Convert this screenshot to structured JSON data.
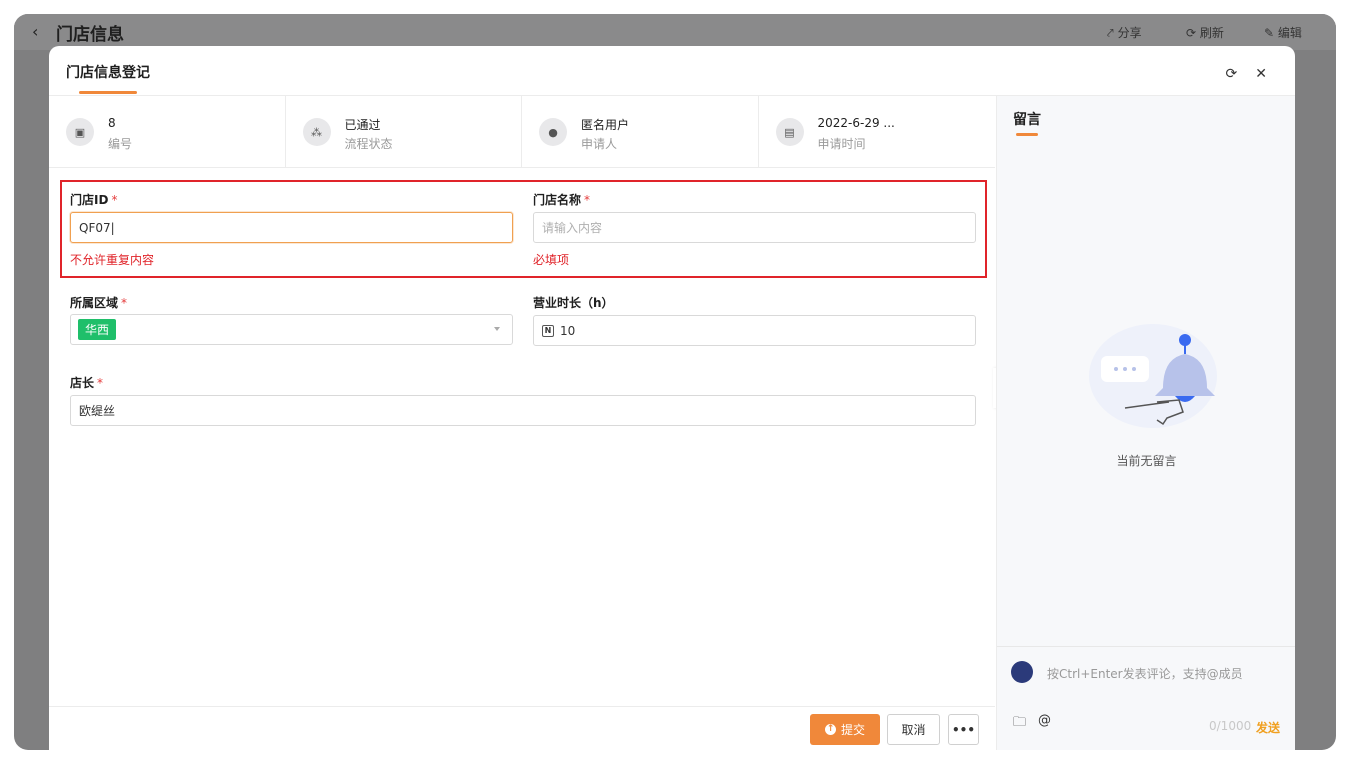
{
  "background": {
    "title": "门店信息",
    "share": "分享",
    "refresh": "刷新",
    "edit": "编辑"
  },
  "modal": {
    "title": "门店信息登记",
    "info": [
      {
        "value": "8",
        "label": "编号",
        "icon": "id-badge-icon"
      },
      {
        "value": "已通过",
        "label": "流程状态",
        "icon": "workflow-icon"
      },
      {
        "value": "匿名用户",
        "label": "申请人",
        "icon": "user-icon"
      },
      {
        "value": "2022-6-29 ...",
        "label": "申请时间",
        "icon": "calendar-icon"
      }
    ],
    "form": {
      "store_id": {
        "label": "门店ID",
        "required": "*",
        "value": "QF07",
        "error": "不允许重复内容"
      },
      "store_name": {
        "label": "门店名称",
        "required": "*",
        "placeholder": "请输入内容",
        "error": "必填项"
      },
      "region": {
        "label": "所属区域",
        "required": "*",
        "value": "华西"
      },
      "hours": {
        "label": "营业时长（h）",
        "value": "10"
      },
      "manager": {
        "label": "店长",
        "required": "*",
        "value": "欧缇丝"
      }
    },
    "footer": {
      "submit": "提交",
      "cancel": "取消",
      "more": "•••"
    }
  },
  "comments": {
    "title": "留言",
    "empty": "当前无留言",
    "placeholder": "按Ctrl+Enter发表评论，支持@成员",
    "count": "0/1000",
    "send": "发送"
  },
  "colors": {
    "accent": "#f0883a",
    "error": "#e0242a",
    "tag": "#1fbf6a"
  }
}
